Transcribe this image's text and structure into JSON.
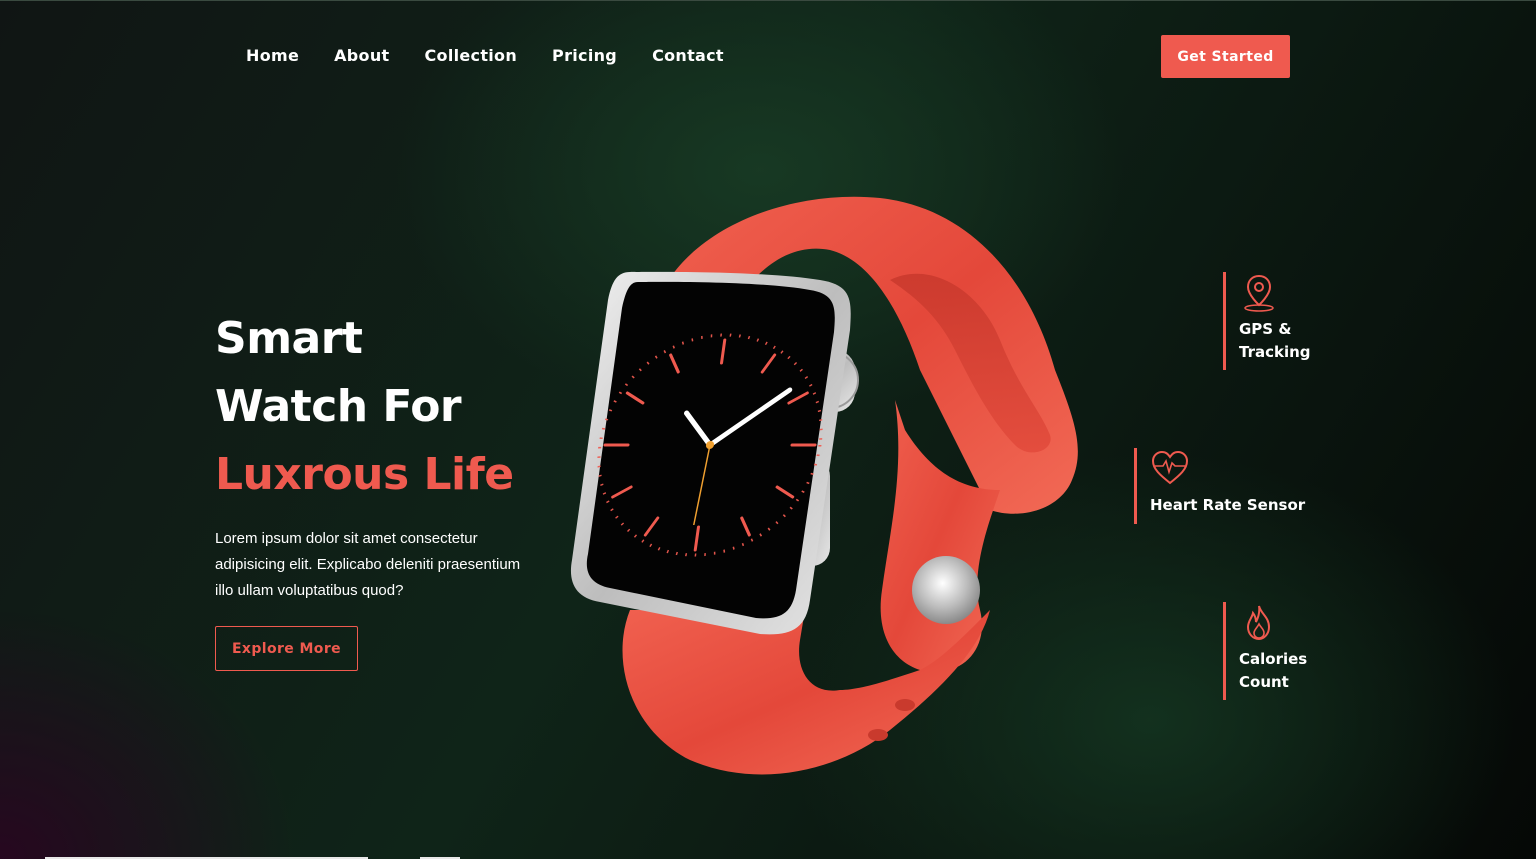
{
  "nav": {
    "items": [
      {
        "label": "Home"
      },
      {
        "label": "About"
      },
      {
        "label": "Collection"
      },
      {
        "label": "Pricing"
      },
      {
        "label": "Contact"
      }
    ],
    "cta_label": "Get Started"
  },
  "hero": {
    "title_line1": "Smart",
    "title_line2": "Watch For",
    "title_accent": "Luxrous Life",
    "description": "Lorem ipsum dolor sit amet consectetur adipisicing elit. Explicabo deleniti praesentium illo ullam voluptatibus quod?",
    "button_label": "Explore More"
  },
  "features": [
    {
      "label_line1": "GPS &",
      "label_line2": "Tracking",
      "icon": "map-pin-icon"
    },
    {
      "label_line1": "Heart Rate Sensor",
      "label_line2": "",
      "icon": "heart-rate-icon"
    },
    {
      "label_line1": "Calories",
      "label_line2": "Count",
      "icon": "flame-icon"
    }
  ],
  "colors": {
    "accent": "#ef5a4f",
    "background": "#0c1510",
    "text": "#ffffff"
  }
}
